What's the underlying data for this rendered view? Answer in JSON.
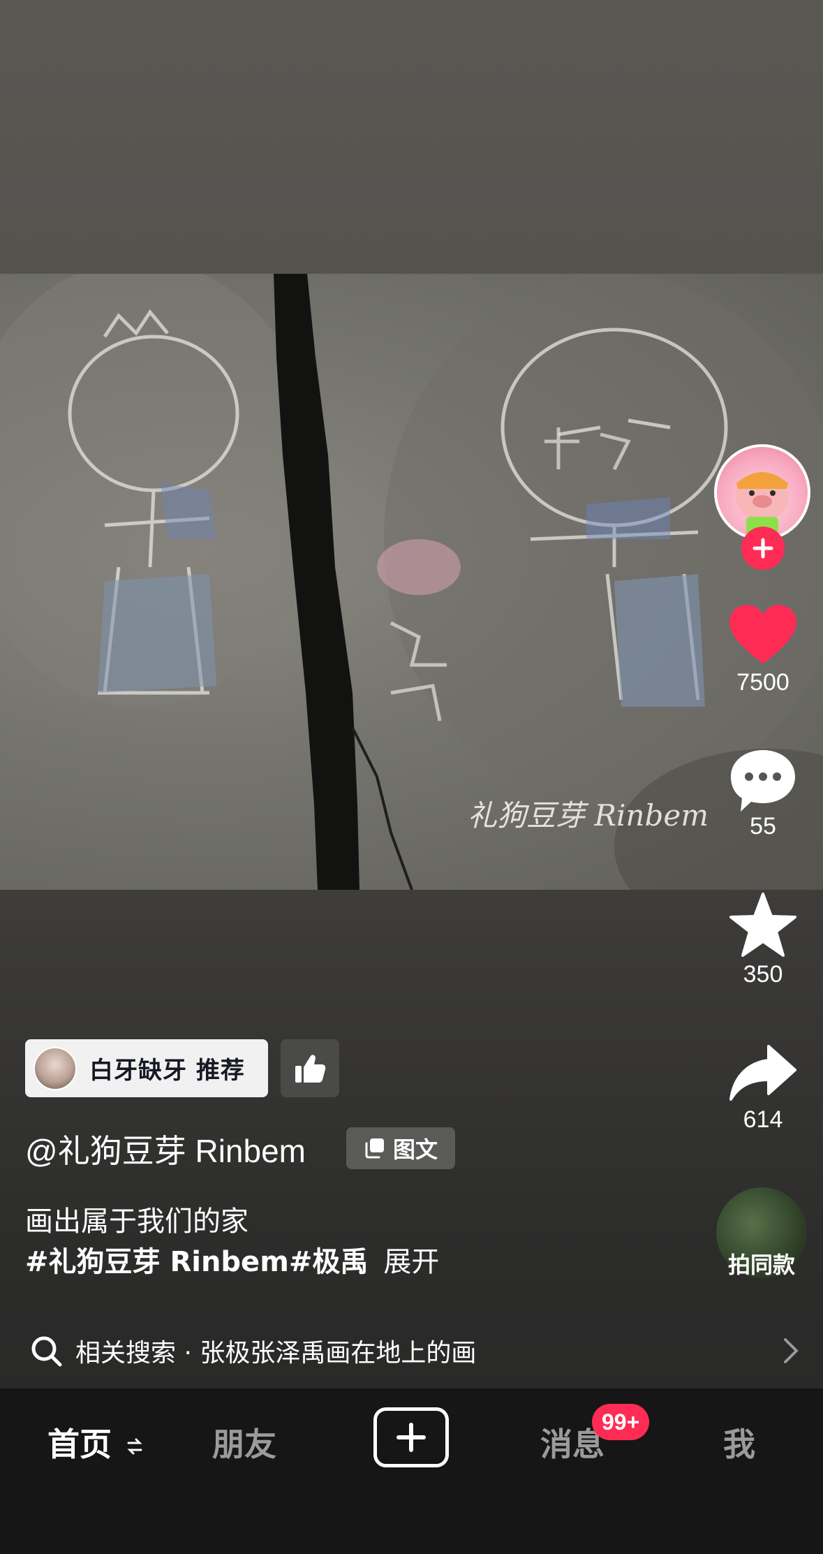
{
  "media": {
    "watermark": "礼狗豆芽 Rinbem"
  },
  "actions": {
    "like_count": "7500",
    "comment_count": "55",
    "favorite_count": "350",
    "share_count": "614"
  },
  "recommendation": {
    "label": "白牙缺牙 推荐"
  },
  "post": {
    "author": "@礼狗豆芽 Rinbem",
    "type_label": "图文",
    "description": "画出属于我们的家",
    "hashtags": "#礼狗豆芽 Rinbem#极禹",
    "expand_label": "展开",
    "same_style_label": "拍同款"
  },
  "related_search": {
    "text": "相关搜索 · 张极张泽禹画在地上的画"
  },
  "nav": {
    "home": "首页",
    "friends": "朋友",
    "messages": "消息",
    "messages_badge": "99+",
    "me": "我"
  },
  "colors": {
    "accent": "#fe2c55",
    "nav_bg": "#161616"
  }
}
